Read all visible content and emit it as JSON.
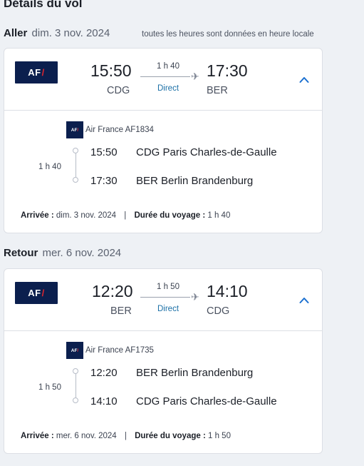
{
  "page": {
    "title": "Détails du vol",
    "timezone_note": "toutes les heures sont données en heure locale"
  },
  "colors": {
    "brand_navy": "#0b1f4e",
    "brand_red": "#e3262f",
    "accent_blue": "#1a6fa6"
  },
  "outbound": {
    "label": "Aller",
    "date": "dim. 3 nov. 2024",
    "logo_text": "AF",
    "dep_time": "15:50",
    "dep_code": "CDG",
    "arr_time": "17:30",
    "arr_code": "BER",
    "duration": "1 h 40",
    "stops": "Direct",
    "airline_flight": "Air France AF1834",
    "small_logo_text": "AF",
    "seg_dep_time": "15:50",
    "seg_dep_airport": "CDG Paris Charles-de-Gaulle",
    "seg_arr_time": "17:30",
    "seg_arr_airport": "BER Berlin Brandenburg",
    "seg_duration": "1 h 40",
    "arrival_label": "Arrivée :",
    "arrival_value": "dim. 3 nov. 2024",
    "separator": "|",
    "travel_label": "Durée du voyage :",
    "travel_value": "1 h 40"
  },
  "return": {
    "label": "Retour",
    "date": "mer. 6 nov. 2024",
    "logo_text": "AF",
    "dep_time": "12:20",
    "dep_code": "BER",
    "arr_time": "14:10",
    "arr_code": "CDG",
    "duration": "1 h 50",
    "stops": "Direct",
    "airline_flight": "Air France AF1735",
    "small_logo_text": "AF",
    "seg_dep_time": "12:20",
    "seg_dep_airport": "BER Berlin Brandenburg",
    "seg_arr_time": "14:10",
    "seg_arr_airport": "CDG Paris Charles-de-Gaulle",
    "seg_duration": "1 h 50",
    "arrival_label": "Arrivée :",
    "arrival_value": "mer. 6 nov. 2024",
    "separator": "|",
    "travel_label": "Durée du voyage :",
    "travel_value": "1 h 50"
  }
}
